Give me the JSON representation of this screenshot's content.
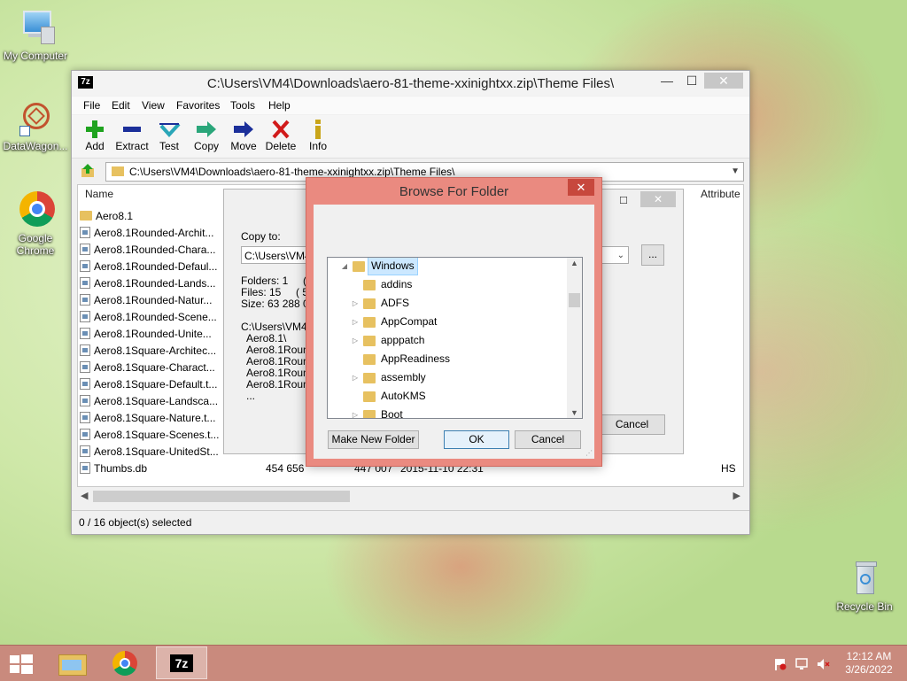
{
  "desktop": {
    "icons": [
      {
        "label": "My Computer"
      },
      {
        "label": "DataWagon..."
      },
      {
        "label": "Google Chrome"
      },
      {
        "label": "Recycle Bin"
      }
    ]
  },
  "window": {
    "app_icon_text": "7z",
    "title": "C:\\Users\\VM4\\Downloads\\aero-81-theme-xxinightxx.zip\\Theme Files\\",
    "controls": {
      "minimize": "—",
      "maximize": "☐",
      "close": "✕"
    },
    "menu": [
      "File",
      "Edit",
      "View",
      "Favorites",
      "Tools",
      "Help"
    ],
    "toolbar": [
      {
        "label": "Add",
        "icon": "plus-icon",
        "color": "#1fa31f"
      },
      {
        "label": "Extract",
        "icon": "minus-icon",
        "color": "#1b2f9a"
      },
      {
        "label": "Test",
        "icon": "check-icon",
        "color": "#2aa6b8"
      },
      {
        "label": "Copy",
        "icon": "arrow-right-icon",
        "color": "#2aa67a"
      },
      {
        "label": "Move",
        "icon": "arrow-right-icon",
        "color": "#1b2f9a"
      },
      {
        "label": "Delete",
        "icon": "x-icon",
        "color": "#d11a1a"
      },
      {
        "label": "Info",
        "icon": "info-icon",
        "color": "#c9a51a"
      }
    ],
    "address": "C:\\Users\\VM4\\Downloads\\aero-81-theme-xxinightxx.zip\\Theme Files\\",
    "columns": {
      "name": "Name",
      "attributes": "Attribute"
    },
    "files": [
      {
        "name": "Aero8.1",
        "type": "folder"
      },
      {
        "name": "Aero8.1Rounded-Archit...",
        "type": "file"
      },
      {
        "name": "Aero8.1Rounded-Chara...",
        "type": "file"
      },
      {
        "name": "Aero8.1Rounded-Defaul...",
        "type": "file"
      },
      {
        "name": "Aero8.1Rounded-Lands...",
        "type": "file"
      },
      {
        "name": "Aero8.1Rounded-Natur...",
        "type": "file"
      },
      {
        "name": "Aero8.1Rounded-Scene...",
        "type": "file"
      },
      {
        "name": "Aero8.1Rounded-Unite...",
        "type": "file"
      },
      {
        "name": "Aero8.1Square-Architec...",
        "type": "file"
      },
      {
        "name": "Aero8.1Square-Charact...",
        "type": "file"
      },
      {
        "name": "Aero8.1Square-Default.t...",
        "type": "file"
      },
      {
        "name": "Aero8.1Square-Landsca...",
        "type": "file"
      },
      {
        "name": "Aero8.1Square-Nature.t...",
        "type": "file"
      },
      {
        "name": "Aero8.1Square-Scenes.t...",
        "type": "file"
      },
      {
        "name": "Aero8.1Square-UnitedSt...",
        "type": "file"
      },
      {
        "name": "Thumbs.db",
        "type": "file",
        "size": "454 656",
        "packed": "447 007",
        "modified": "2015-11-10 22:31",
        "attr": "HS"
      }
    ],
    "status": "0 / 16 object(s) selected"
  },
  "copy_dialog": {
    "copy_to_label": "Copy to:",
    "path": "C:\\Users\\VM4\\",
    "browse_button": "...",
    "info_lines": [
      "Folders: 1     ( 62",
      "Files: 15     ( 530",
      "Size: 63 288 00"
    ],
    "list_lines": [
      "C:\\Users\\VM4\\",
      "Aero8.1\\",
      "Aero8.1Round",
      "Aero8.1Round",
      "Aero8.1Round",
      "Aero8.1Round",
      "..."
    ],
    "cancel": "Cancel"
  },
  "browse_dialog": {
    "title": "Browse For Folder",
    "close": "✕",
    "tree": [
      {
        "label": "Windows",
        "expanded": true,
        "level": 0,
        "selected": true
      },
      {
        "label": "addins",
        "level": 1,
        "has_children": false
      },
      {
        "label": "ADFS",
        "level": 1,
        "has_children": true
      },
      {
        "label": "AppCompat",
        "level": 1,
        "has_children": true
      },
      {
        "label": "apppatch",
        "level": 1,
        "has_children": true
      },
      {
        "label": "AppReadiness",
        "level": 1,
        "has_children": false
      },
      {
        "label": "assembly",
        "level": 1,
        "has_children": true
      },
      {
        "label": "AutoKMS",
        "level": 1,
        "has_children": false
      },
      {
        "label": "Boot",
        "level": 1,
        "has_children": true
      }
    ],
    "make_new_folder": "Make New Folder",
    "ok": "OK",
    "cancel": "Cancel"
  },
  "taskbar": {
    "time": "12:12 AM",
    "date": "3/26/2022",
    "active_app_text": "7z"
  }
}
